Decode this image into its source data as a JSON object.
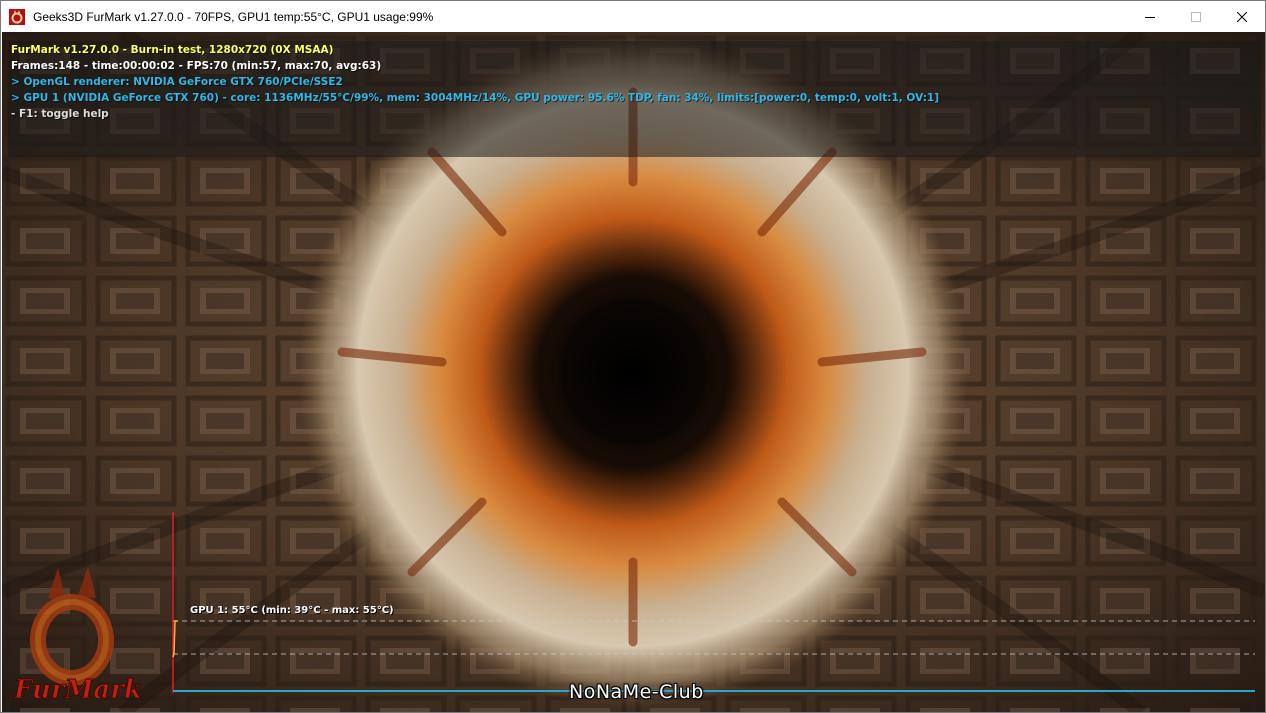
{
  "window": {
    "title": "Geeks3D FurMark v1.27.0.0 - 70FPS, GPU1 temp:55°C, GPU1 usage:99%",
    "controls": [
      "minimize",
      "maximize",
      "close"
    ]
  },
  "hud": {
    "lines": [
      {
        "text": "FurMark v1.27.0.0 - Burn-in test, 1280x720 (0X MSAA)",
        "color": "#ffff66"
      },
      {
        "text": "Frames:148 - time:00:00:02 - FPS:70 (min:57, max:70, avg:63)",
        "color": "#ffffff"
      },
      {
        "text": "> OpenGL renderer: NVIDIA GeForce GTX 760/PCIe/SSE2",
        "color": "#2fb8e8"
      },
      {
        "text": "> GPU 1 (NVIDIA GeForce GTX 760) - core: 1136MHz/55°C/99%, mem: 3004MHz/14%, GPU power: 95.6% TDP, fan: 34%, limits:[power:0, temp:0, volt:1, OV:1]",
        "color": "#2fb8e8"
      },
      {
        "text": "- F1: toggle help",
        "color": "#dddddd"
      }
    ]
  },
  "temp_graph": {
    "label": "GPU 1: 55°C (min: 39°C - max: 55°C)",
    "current_c": 55,
    "min_c": 39,
    "max_c": 55,
    "line_color": "#ffb040",
    "axis_color": "#2ba6c8",
    "marker_color": "#e02020"
  },
  "logo": {
    "text": "FurMark"
  },
  "watermark": "NoNaMe-Club",
  "colors": {
    "window_bg": "#ffffff",
    "hud_bg": "#191919"
  }
}
